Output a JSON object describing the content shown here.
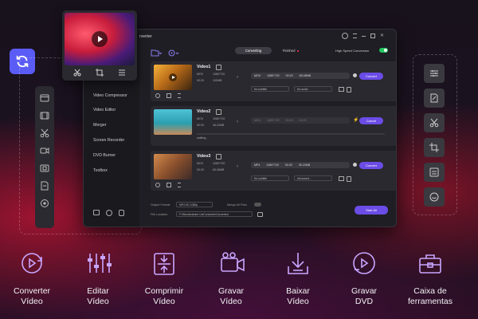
{
  "app": {
    "title_fragment": "nverter",
    "tabs": {
      "converting": "Converting",
      "finished": "Finished"
    },
    "high_speed_label": "High Speed Conversion"
  },
  "menu": [
    "Video Compressor",
    "Video Editor",
    "Merger",
    "Screen Recorder",
    "DVD Burner",
    "Toolbox"
  ],
  "videos": [
    {
      "name": "Video1",
      "src_format": "MOV",
      "src_res": "1080*720",
      "src_dur": "00:20",
      "src_size": "100MB",
      "out_format": "MOV",
      "out_res": "1080*720",
      "out_dur": "00:20",
      "out_size": "65.08MB",
      "subtitle": "No subtitle",
      "audio": "No audio",
      "action": "Convert",
      "accent": "#6b4ce6"
    },
    {
      "name": "Video2",
      "src_format": "MOV",
      "src_res": "1080*720",
      "src_dur": "00:20",
      "src_size": "46.22MB",
      "out_format": "MOV",
      "out_res": "1080*720",
      "out_dur": "00:20",
      "out_size": "00:20",
      "status": "waiting...",
      "action": "Cancel",
      "accent": "#6b4ce6"
    },
    {
      "name": "Video3",
      "src_format": "MOV",
      "src_res": "1080*720",
      "src_dur": "00:20",
      "src_size": "65.08MB",
      "out_format": "MP4",
      "out_res": "1080*720",
      "out_dur": "00:20",
      "out_size": "35.23MB",
      "subtitle": "No subtitle",
      "audio": "Advanced...",
      "action": "Convert",
      "accent": "#6b4ce6"
    }
  ],
  "footer": {
    "output_format_label": "Output Format",
    "output_format_value": "MP4 HD 1080p",
    "merge_label": "Merge All Files",
    "file_location_label": "File Location",
    "file_location_value": "F:\\Wondershare UniConverter\\Converted",
    "start_all": "Start All"
  },
  "features": [
    {
      "icon": "convert-video-icon",
      "label": "Converter\nVídeo"
    },
    {
      "icon": "edit-video-icon",
      "label": "Editar\nVídeo"
    },
    {
      "icon": "compress-video-icon",
      "label": "Comprimir\nVídeo"
    },
    {
      "icon": "record-video-icon",
      "label": "Gravar\nVídeo"
    },
    {
      "icon": "download-video-icon",
      "label": "Baixar\nVídeo"
    },
    {
      "icon": "burn-dvd-icon",
      "label": "Gravar\nDVD"
    },
    {
      "icon": "toolbox-icon",
      "label": "Caixa de\nferramentas"
    }
  ],
  "colors": {
    "accent": "#6b4ce6",
    "feature_icon": "#c9a6ff",
    "convert_badge": "#5b5cf6",
    "toggle_on": "#22c55e"
  }
}
